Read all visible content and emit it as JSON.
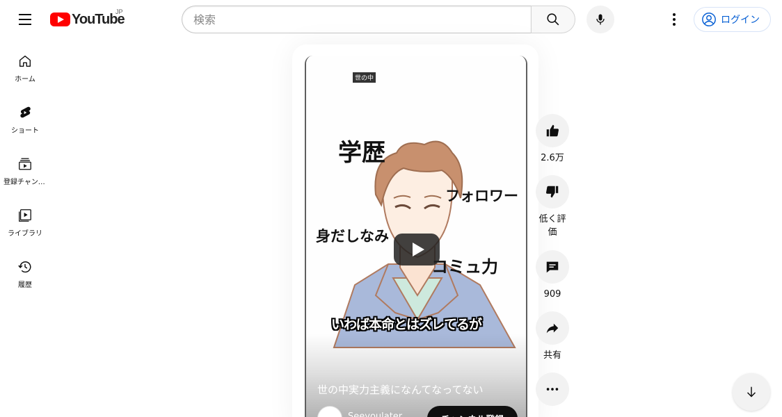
{
  "header": {
    "logo_text": "YouTube",
    "country_code": "JP",
    "search_placeholder": "検索",
    "login_label": "ログイン"
  },
  "sidebar": {
    "items": [
      {
        "label": "ホーム",
        "icon": "home-icon"
      },
      {
        "label": "ショート",
        "icon": "shorts-icon"
      },
      {
        "label": "登録チャンネル",
        "icon": "subscriptions-icon"
      },
      {
        "label": "ライブラリ",
        "icon": "library-icon"
      },
      {
        "label": "履歴",
        "icon": "history-icon"
      }
    ]
  },
  "video": {
    "tag": "世の中",
    "words": [
      "学歴",
      "フォロワー",
      "身だしなみ",
      "コミュ力"
    ],
    "caption": "いわば本命とはズレてるが",
    "title": "世の中実力主義になんてなってない",
    "channel_name": "Seeyoulater",
    "subscribe_label": "チャンネル登録"
  },
  "actions": {
    "like_count": "2.6万",
    "dislike_label": "低く評価",
    "comment_count": "909",
    "share_label": "共有"
  }
}
